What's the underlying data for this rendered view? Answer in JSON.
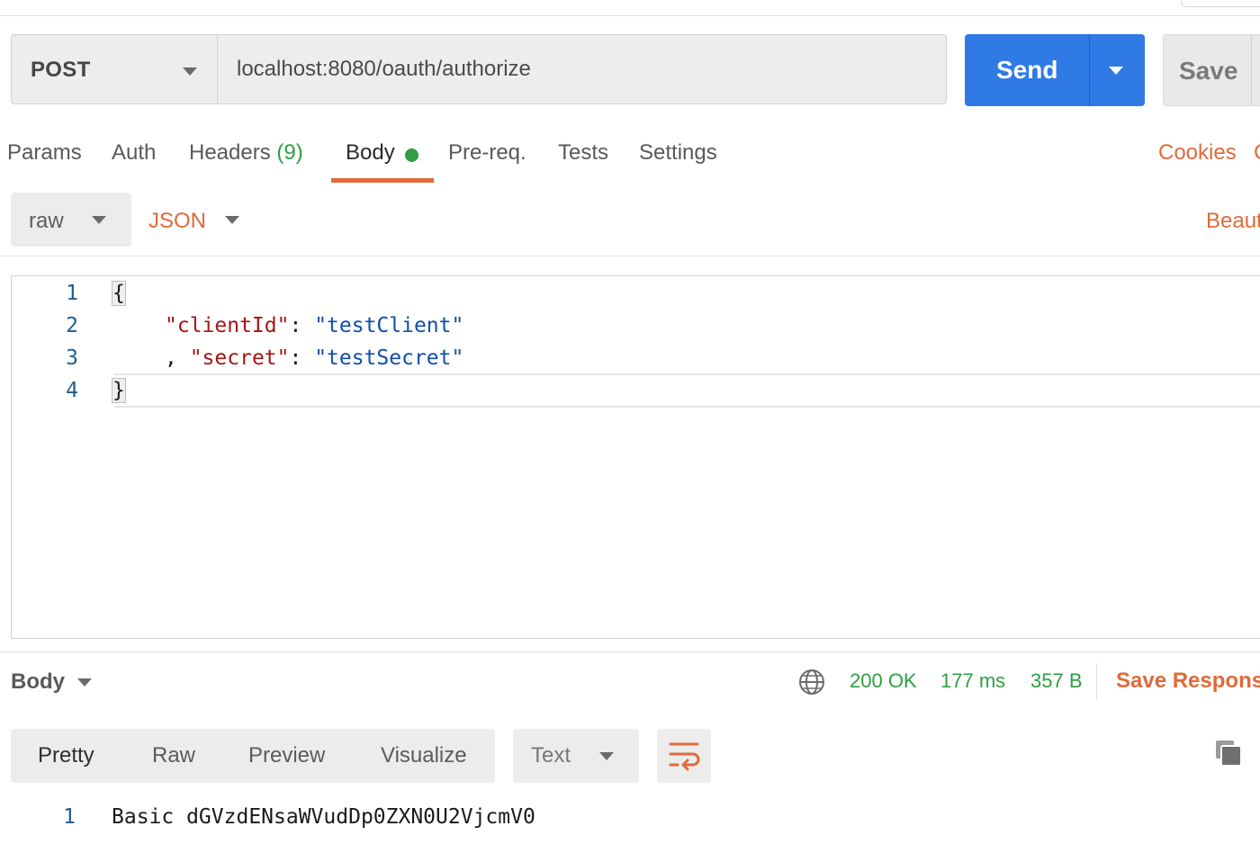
{
  "request": {
    "method": "POST",
    "url": "localhost:8080/oauth/authorize",
    "send_label": "Send",
    "save_label": "Save"
  },
  "tabs": {
    "params": "Params",
    "auth": "Auth",
    "headers": "Headers",
    "headers_count": "(9)",
    "body": "Body",
    "prereq": "Pre-req.",
    "tests": "Tests",
    "settings": "Settings",
    "cookies": "Cookies",
    "cookies_cut": "C"
  },
  "body_toolbar": {
    "mode": "raw",
    "language": "JSON",
    "beautify": "Beaut"
  },
  "editor": {
    "line_numbers": [
      "1",
      "2",
      "3",
      "4"
    ],
    "line1": "{",
    "line2_key": "\"clientId\"",
    "line2_sep": ": ",
    "line2_val": "\"testClient\"",
    "line3_lead": ", ",
    "line3_key": "\"secret\"",
    "line3_sep": ": ",
    "line3_val": "\"testSecret\"",
    "line4": "}"
  },
  "response": {
    "section_label": "Body",
    "status": "200 OK",
    "time": "177 ms",
    "size": "357 B",
    "save_response": "Save Respons",
    "views": [
      "Pretty",
      "Raw",
      "Preview",
      "Visualize"
    ],
    "format": "Text",
    "line_number": "1",
    "content": "Basic dGVzdENsaWVudDp0ZXN0U2VjcmV0"
  },
  "colors": {
    "accent_orange": "#e06a3b",
    "send_blue": "#2f7ae5",
    "status_green": "#2f9e44"
  }
}
